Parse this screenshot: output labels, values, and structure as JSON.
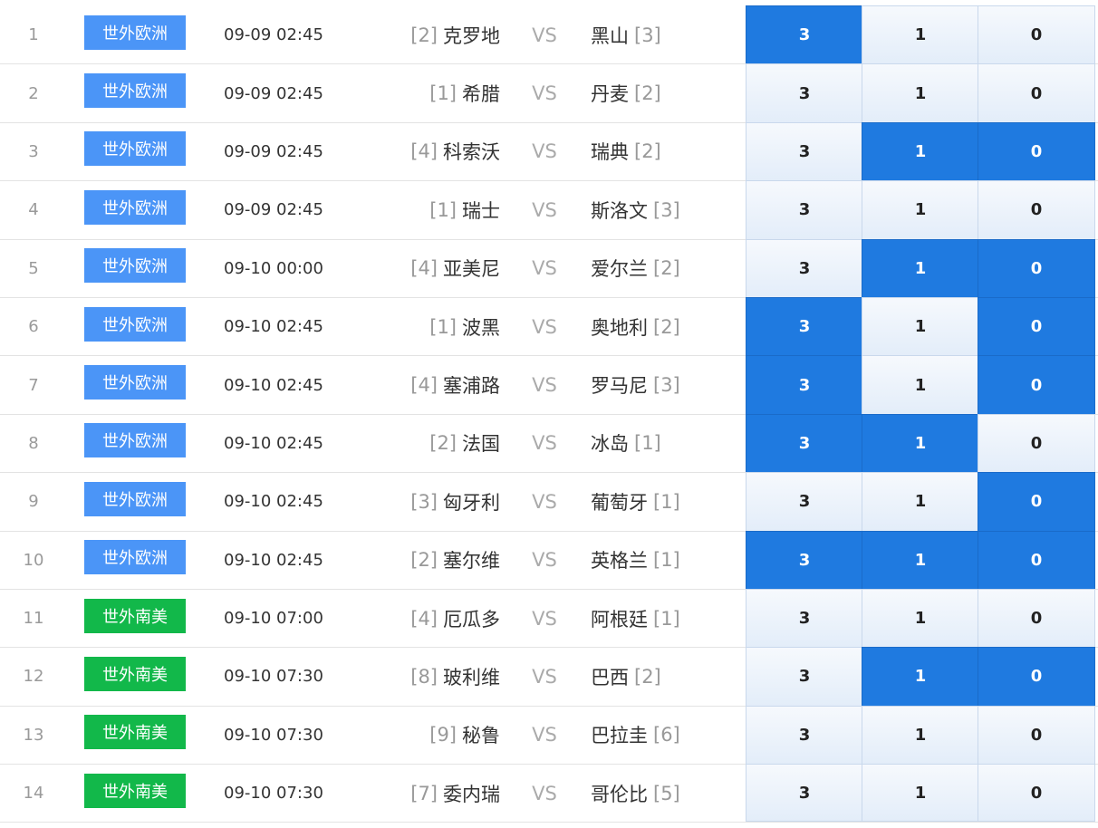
{
  "matches": [
    {
      "num": "1",
      "league": "世外欧洲",
      "league_type": "europe",
      "time": "09-09 02:45",
      "home_rank": "[2]",
      "home": "克罗地",
      "vs": "VS",
      "away": "黑山",
      "away_rank": "[3]",
      "opt_labels": [
        "3",
        "1",
        "0"
      ],
      "selected": [
        true,
        false,
        false
      ]
    },
    {
      "num": "2",
      "league": "世外欧洲",
      "league_type": "europe",
      "time": "09-09 02:45",
      "home_rank": "[1]",
      "home": "希腊",
      "vs": "VS",
      "away": "丹麦",
      "away_rank": "[2]",
      "opt_labels": [
        "3",
        "1",
        "0"
      ],
      "selected": [
        false,
        false,
        false
      ]
    },
    {
      "num": "3",
      "league": "世外欧洲",
      "league_type": "europe",
      "time": "09-09 02:45",
      "home_rank": "[4]",
      "home": "科索沃",
      "vs": "VS",
      "away": "瑞典",
      "away_rank": "[2]",
      "opt_labels": [
        "3",
        "1",
        "0"
      ],
      "selected": [
        false,
        true,
        true
      ]
    },
    {
      "num": "4",
      "league": "世外欧洲",
      "league_type": "europe",
      "time": "09-09 02:45",
      "home_rank": "[1]",
      "home": "瑞士",
      "vs": "VS",
      "away": "斯洛文",
      "away_rank": "[3]",
      "opt_labels": [
        "3",
        "1",
        "0"
      ],
      "selected": [
        false,
        false,
        false
      ]
    },
    {
      "num": "5",
      "league": "世外欧洲",
      "league_type": "europe",
      "time": "09-10 00:00",
      "home_rank": "[4]",
      "home": "亚美尼",
      "vs": "VS",
      "away": "爱尔兰",
      "away_rank": "[2]",
      "opt_labels": [
        "3",
        "1",
        "0"
      ],
      "selected": [
        false,
        true,
        true
      ]
    },
    {
      "num": "6",
      "league": "世外欧洲",
      "league_type": "europe",
      "time": "09-10 02:45",
      "home_rank": "[1]",
      "home": "波黑",
      "vs": "VS",
      "away": "奥地利",
      "away_rank": "[2]",
      "opt_labels": [
        "3",
        "1",
        "0"
      ],
      "selected": [
        true,
        false,
        true
      ]
    },
    {
      "num": "7",
      "league": "世外欧洲",
      "league_type": "europe",
      "time": "09-10 02:45",
      "home_rank": "[4]",
      "home": "塞浦路",
      "vs": "VS",
      "away": "罗马尼",
      "away_rank": "[3]",
      "opt_labels": [
        "3",
        "1",
        "0"
      ],
      "selected": [
        true,
        false,
        true
      ]
    },
    {
      "num": "8",
      "league": "世外欧洲",
      "league_type": "europe",
      "time": "09-10 02:45",
      "home_rank": "[2]",
      "home": "法国",
      "vs": "VS",
      "away": "冰岛",
      "away_rank": "[1]",
      "opt_labels": [
        "3",
        "1",
        "0"
      ],
      "selected": [
        true,
        true,
        false
      ]
    },
    {
      "num": "9",
      "league": "世外欧洲",
      "league_type": "europe",
      "time": "09-10 02:45",
      "home_rank": "[3]",
      "home": "匈牙利",
      "vs": "VS",
      "away": "葡萄牙",
      "away_rank": "[1]",
      "opt_labels": [
        "3",
        "1",
        "0"
      ],
      "selected": [
        false,
        false,
        true
      ]
    },
    {
      "num": "10",
      "league": "世外欧洲",
      "league_type": "europe",
      "time": "09-10 02:45",
      "home_rank": "[2]",
      "home": "塞尔维",
      "vs": "VS",
      "away": "英格兰",
      "away_rank": "[1]",
      "opt_labels": [
        "3",
        "1",
        "0"
      ],
      "selected": [
        true,
        true,
        true
      ]
    },
    {
      "num": "11",
      "league": "世外南美",
      "league_type": "samerica",
      "time": "09-10 07:00",
      "home_rank": "[4]",
      "home": "厄瓜多",
      "vs": "VS",
      "away": "阿根廷",
      "away_rank": "[1]",
      "opt_labels": [
        "3",
        "1",
        "0"
      ],
      "selected": [
        false,
        false,
        false
      ]
    },
    {
      "num": "12",
      "league": "世外南美",
      "league_type": "samerica",
      "time": "09-10 07:30",
      "home_rank": "[8]",
      "home": "玻利维",
      "vs": "VS",
      "away": "巴西",
      "away_rank": "[2]",
      "opt_labels": [
        "3",
        "1",
        "0"
      ],
      "selected": [
        false,
        true,
        true
      ]
    },
    {
      "num": "13",
      "league": "世外南美",
      "league_type": "samerica",
      "time": "09-10 07:30",
      "home_rank": "[9]",
      "home": "秘鲁",
      "vs": "VS",
      "away": "巴拉圭",
      "away_rank": "[6]",
      "opt_labels": [
        "3",
        "1",
        "0"
      ],
      "selected": [
        false,
        false,
        false
      ]
    },
    {
      "num": "14",
      "league": "世外南美",
      "league_type": "samerica",
      "time": "09-10 07:30",
      "home_rank": "[7]",
      "home": "委内瑞",
      "vs": "VS",
      "away": "哥伦比",
      "away_rank": "[5]",
      "opt_labels": [
        "3",
        "1",
        "0"
      ],
      "selected": [
        false,
        false,
        false
      ]
    }
  ],
  "colors": {
    "selected": "#1f7ae0",
    "europe_badge": "#4b95f7",
    "samerica_badge": "#12b84a"
  }
}
